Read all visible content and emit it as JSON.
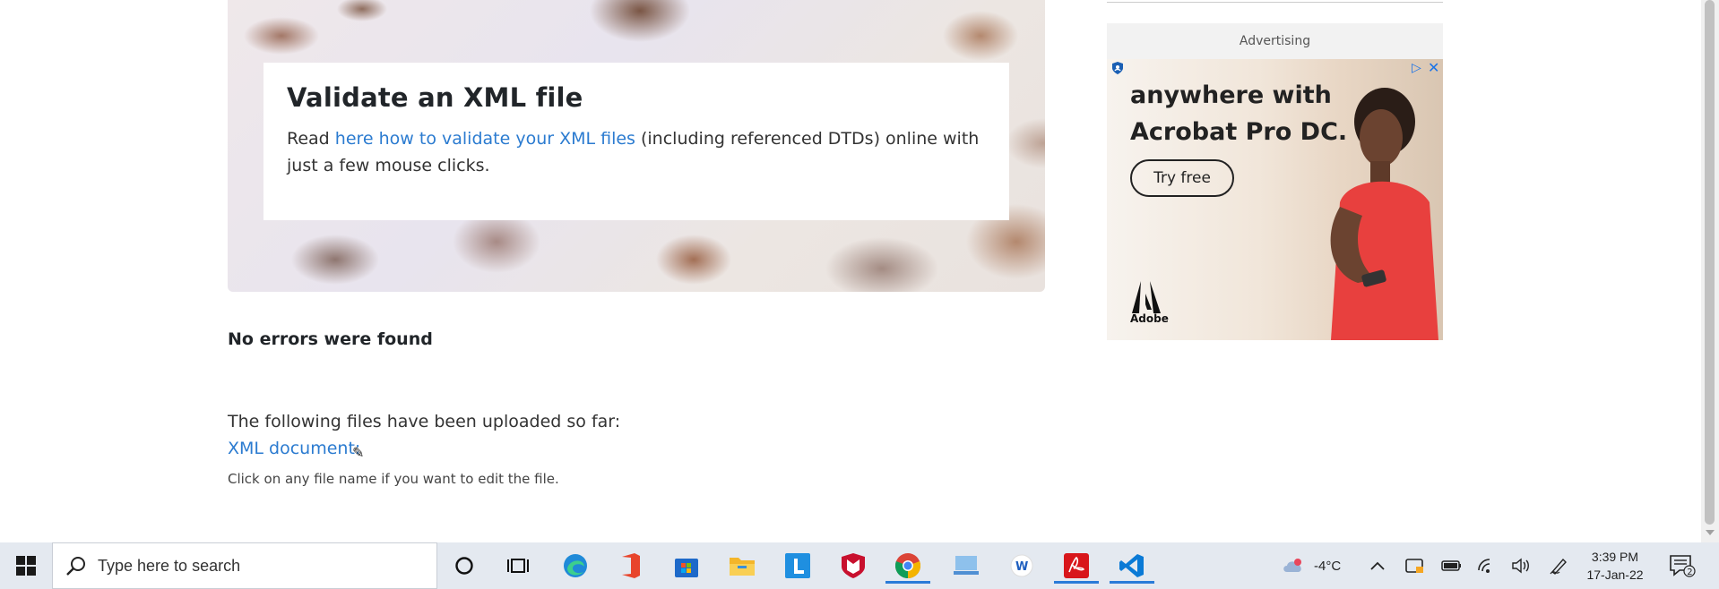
{
  "hero": {
    "title": "Validate an XML file",
    "text_before": "Read ",
    "link_text": "here how to validate your XML files",
    "text_after": " (including referenced DTDs) online with just a few mouse clicks."
  },
  "result": {
    "message": "No errors were found"
  },
  "uploads": {
    "intro": "The following files have been uploaded so far:",
    "file_link": "XML document:",
    "hint": "Click on any file name if you want to edit the file."
  },
  "ad": {
    "label": "Advertising",
    "headline_line1": "anywhere with",
    "headline_line2": "Acrobat Pro DC.",
    "cta": "Try free",
    "brand": "Adobe"
  },
  "taskbar": {
    "search_placeholder": "Type here to search",
    "weather": "-4°C",
    "time": "3:39 PM",
    "date": "17-Jan-22",
    "notification_count": "2",
    "apps": [
      "cortana",
      "task-view",
      "edge",
      "office",
      "microsoft-store",
      "file-explorer",
      "l-app",
      "mcafee",
      "chrome",
      "desktop-app",
      "word-app",
      "acrobat",
      "vscode"
    ]
  },
  "colors": {
    "link": "#2b7bd0",
    "taskbar_bg": "#e4e9f0",
    "active_underline": "#2a7bd8"
  }
}
